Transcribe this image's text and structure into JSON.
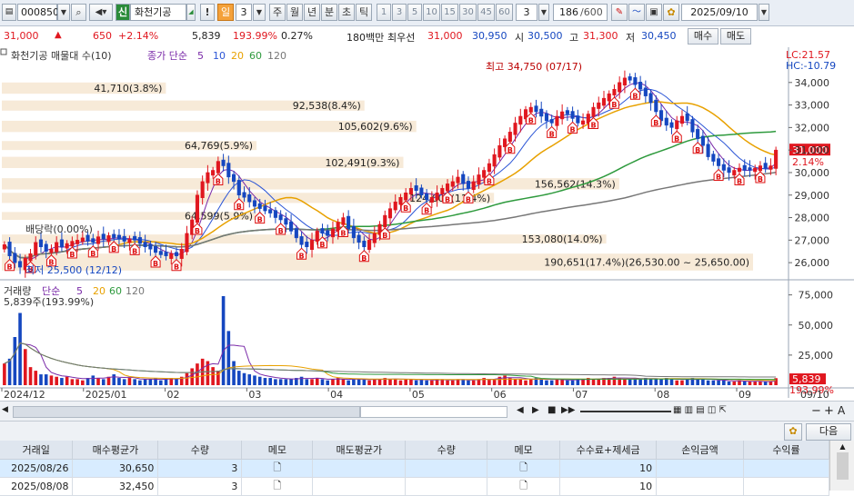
{
  "toolbar": {
    "code": "000850",
    "badge": "신",
    "name": "화천기공",
    "exclaim": "!",
    "period_active": "일",
    "period_n": "3",
    "periods": [
      "주",
      "월",
      "년",
      "분",
      "초",
      "틱"
    ],
    "presets": [
      "1",
      "3",
      "5",
      "10",
      "15",
      "30",
      "45",
      "60"
    ],
    "preset_sel": "3",
    "count": "186",
    "count_total": "/600",
    "date": "2025/09/10"
  },
  "quote": {
    "price": "31,000",
    "change": "650",
    "change_pct": "+2.14%",
    "volume": "5,839",
    "vol_ratio": "193.99%",
    "turnover_pct": "0.27%",
    "amount": "180백만",
    "ask_label": "최우선",
    "ask": "31,000",
    "bid": "30,950",
    "open_label": "시",
    "open": "30,500",
    "high_label": "고",
    "high": "31,300",
    "low_label": "저",
    "low": "30,450",
    "buy_label": "매수",
    "sell_label": "매도"
  },
  "colors": {
    "up": "#e0171f",
    "down": "#1547c0",
    "ma5": "#7a2aa8",
    "ma10": "#2b55d6",
    "ma20": "#e8a100",
    "ma60": "#2e9a3d",
    "ma120": "#777777",
    "band": "#f7ead8"
  },
  "chart_data": {
    "type": "candlestick",
    "price_legend": {
      "title": "화천기공 매물대 수(10)",
      "ma_label": "종가 단순",
      "ma_periods": [
        "5",
        "10",
        "20",
        "60",
        "120"
      ]
    },
    "lc": "LC:21.57",
    "hc": "HC:-10.79",
    "y_ticks": [
      "34,000",
      "33,000",
      "32,000",
      "31,000",
      "30,000",
      "29,000",
      "28,000",
      "27,000",
      "26,000"
    ],
    "ylim": [
      25400,
      35000
    ],
    "last_price": "31,000",
    "last_pct": "2.14%",
    "high_note": "최고 34,750 (07/17)",
    "low_note": "최저 25,500 (12/12)",
    "dividend_note": "배당락(0.00%)",
    "volume_profile": [
      {
        "label": "41,710(3.8%)",
        "price_hi": 34000,
        "price_lo": 33500,
        "share": 3.8
      },
      {
        "label": "92,538(8.4%)",
        "price_hi": 33200,
        "price_lo": 32750,
        "share": 8.4
      },
      {
        "label": "105,602(9.6%)",
        "price_hi": 32300,
        "price_lo": 31800,
        "share": 9.6
      },
      {
        "label": "64,769(5.9%)",
        "price_hi": 31400,
        "price_lo": 31000,
        "share": 5.9
      },
      {
        "label": "102,491(9.3%)",
        "price_hi": 30700,
        "price_lo": 30200,
        "share": 9.3
      },
      {
        "label": "156,562(14.3%)",
        "price_hi": 29750,
        "price_lo": 29250,
        "share": 14.3
      },
      {
        "label": "124,607(11.4%)",
        "price_hi": 29100,
        "price_lo": 28650,
        "share": 11.4
      },
      {
        "label": "64,599(5.9%)",
        "price_hi": 28250,
        "price_lo": 27900,
        "share": 5.9
      },
      {
        "label": "153,080(14.0%)",
        "price_hi": 27250,
        "price_lo": 26850,
        "share": 14.0
      },
      {
        "label": "190,651(17.4%)(26,530.00 ~ 25,650.00)",
        "price_hi": 26400,
        "price_lo": 25650,
        "share": 17.4
      }
    ],
    "volume_legend": {
      "title": "거래량",
      "ma_label": "단순",
      "ma_periods": [
        "5",
        "20",
        "60",
        "120"
      ]
    },
    "volume_note": "5,839주(193.99%)",
    "vol_ticks": [
      "75,000",
      "50,000",
      "25,000"
    ],
    "vol_ylim": [
      0,
      80000
    ],
    "last_volume": "5,839",
    "last_vol_pct": "193.99%",
    "x_ticks": [
      "2024/12",
      "2025/01",
      "02",
      "03",
      "04",
      "05",
      "06",
      "07",
      "08",
      "09",
      "09/10"
    ],
    "closes": [
      26800,
      26300,
      26000,
      25800,
      26200,
      26400,
      26900,
      26700,
      26500,
      26600,
      26900,
      26700,
      26850,
      26950,
      27000,
      27100,
      26950,
      26900,
      27150,
      27050,
      27200,
      27100,
      27050,
      26950,
      27050,
      27000,
      26850,
      26700,
      26600,
      26450,
      26350,
      26300,
      26400,
      26300,
      26600,
      27300,
      27900,
      29000,
      29600,
      30000,
      30100,
      30500,
      30300,
      29800,
      29600,
      29000,
      28900,
      28700,
      28500,
      28400,
      28300,
      28200,
      28000,
      27900,
      27700,
      27400,
      27100,
      26800,
      26700,
      27000,
      27400,
      27300,
      27200,
      27500,
      27800,
      28000,
      27500,
      27100,
      26900,
      26700,
      27000,
      27300,
      27700,
      28100,
      28400,
      28700,
      28900,
      29100,
      29300,
      29200,
      29000,
      28800,
      28900,
      29100,
      29300,
      29500,
      29600,
      29800,
      29500,
      29300,
      29600,
      29900,
      30100,
      30400,
      30800,
      31200,
      31500,
      31800,
      32200,
      32500,
      32800,
      32900,
      32700,
      32500,
      32300,
      32200,
      32500,
      32700,
      32600,
      32400,
      32200,
      32300,
      32600,
      32900,
      33100,
      33300,
      33500,
      33700,
      34000,
      34200,
      34100,
      33900,
      33700,
      33400,
      33100,
      32700,
      32300,
      32100,
      32000,
      32300,
      32500,
      32300,
      31800,
      31500,
      31200,
      30700,
      30500,
      30300,
      30100,
      30000,
      30100,
      30200,
      30100,
      30100,
      30200,
      30300,
      30200,
      30300,
      31000
    ],
    "volumes": [
      18000,
      22000,
      40000,
      60000,
      30000,
      15000,
      12000,
      9000,
      9000,
      8000,
      7000,
      6000,
      7000,
      5000,
      5000,
      4000,
      6000,
      8000,
      6000,
      5000,
      7000,
      9000,
      6000,
      5000,
      6000,
      5000,
      4000,
      5000,
      5000,
      6000,
      4000,
      5000,
      6000,
      5000,
      7000,
      10000,
      14000,
      18000,
      22000,
      20000,
      15000,
      12000,
      74000,
      45000,
      20000,
      12000,
      10000,
      9000,
      8000,
      7000,
      6000,
      6000,
      5000,
      5000,
      5000,
      5000,
      6000,
      7000,
      5000,
      5000,
      6000,
      5000,
      4000,
      5000,
      6000,
      5000,
      4000,
      5000,
      5000,
      5000,
      4000,
      5000,
      5000,
      6000,
      5000,
      5000,
      4000,
      5000,
      5000,
      4000,
      5000,
      4000,
      4000,
      5000,
      5000,
      4000,
      4000,
      5000,
      5000,
      4000,
      4000,
      5000,
      6000,
      5000,
      5000,
      7000,
      8000,
      6000,
      5000,
      5000,
      4000,
      5000,
      6000,
      5000,
      4000,
      4000,
      5000,
      5000,
      4000,
      4000,
      5000,
      5000,
      6000,
      5000,
      5000,
      6000,
      6000,
      7000,
      6000,
      5000,
      5000,
      6000,
      5000,
      6000,
      5000,
      5000,
      5000,
      6000,
      5000,
      4000,
      4000,
      5000,
      6000,
      5000,
      5000,
      4000,
      4000,
      4000,
      4000,
      3000,
      3000,
      4000,
      3000,
      3000,
      3000,
      3000,
      3000,
      3000,
      5839
    ]
  },
  "scrollbar": {
    "icons": [
      "◀",
      "▶",
      "■",
      "▶▶"
    ],
    "zoom_minus": "−",
    "zoom_plus": "+",
    "font_a": "A"
  },
  "trades": {
    "next_label": "다음",
    "headers": [
      "거래일",
      "매수평균가",
      "수량",
      "메모",
      "매도평균가",
      "수량",
      "메모",
      "수수료+제세금",
      "손익금액",
      "수익률"
    ],
    "rows": [
      {
        "date": "2025/08/26",
        "buy_avg": "30,650",
        "qty": "3",
        "fee": "10"
      },
      {
        "date": "2025/08/08",
        "buy_avg": "32,450",
        "qty": "3",
        "fee": "10"
      }
    ]
  }
}
